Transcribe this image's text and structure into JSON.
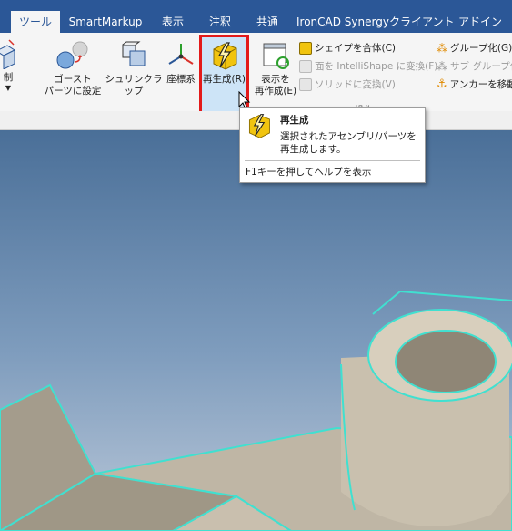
{
  "tabs": [
    {
      "label": "ツール",
      "active": true
    },
    {
      "label": "SmartMarkup"
    },
    {
      "label": "表示"
    },
    {
      "label": "注釈"
    },
    {
      "label": "共通"
    },
    {
      "label": "IronCAD Synergyクライアント"
    },
    {
      "label": "アドイン"
    }
  ],
  "ribbon": {
    "control_label": "制",
    "ghost_label_1": "ゴースト",
    "ghost_label_2": "パーツに設定",
    "shrinkwrap_label": "シュリンクラップ",
    "coordinate_label": "座標系",
    "regenerate_label": "再生成(R)",
    "recreate_view_label_1": "表示を",
    "recreate_view_label_2": "再作成(E)",
    "combine_shapes": "シェイプを合体(C)",
    "convert_to_intellishape": "面を IntelliShape に変換(F)",
    "convert_to_solid": "ソリッドに変換(V)",
    "group_label": "グループ化(G)",
    "subgroup_label": "サブ グループ化",
    "move_anchor": "アンカーを移動(",
    "group_caption": "操作"
  },
  "tooltip": {
    "title": "再生成",
    "description": "選択されたアセンブリ/パーツを再生成します。",
    "help": "F1キーを押してヘルプを表示"
  },
  "colors": {
    "tab_bar": "#2b5797",
    "highlight_border": "#e31a1a",
    "edge_highlight": "#40e0d0",
    "part_face": "#c9bfae"
  }
}
